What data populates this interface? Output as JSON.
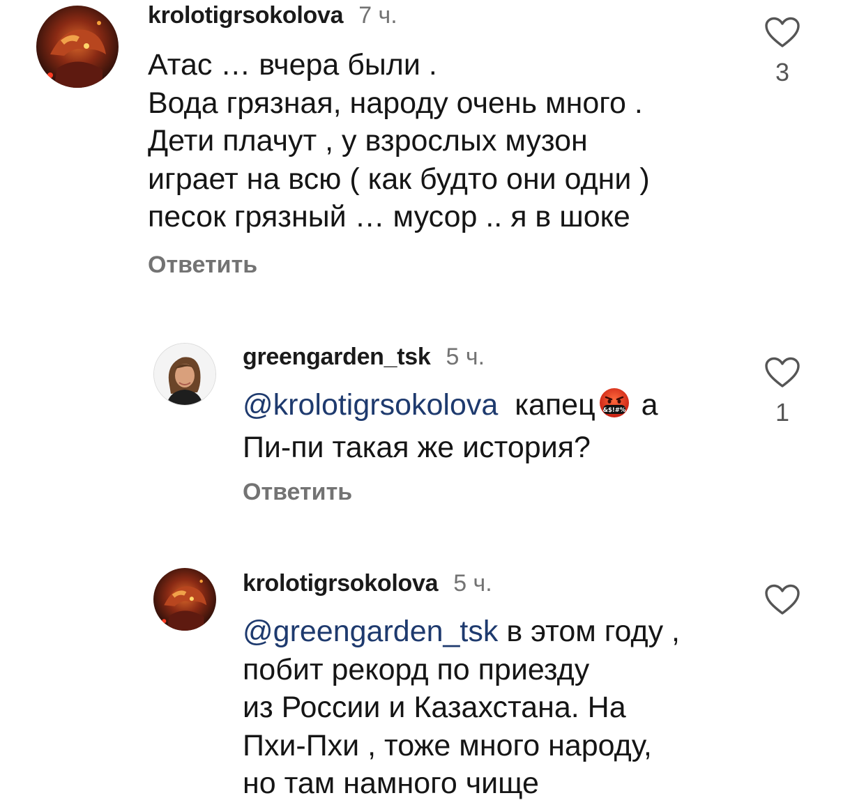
{
  "comments": [
    {
      "username": "krolotigrsokolova",
      "time": "7 ч.",
      "avatar": "dragon-avatar",
      "lines": [
        "Атас … вчера были .",
        "Вода грязная, народу очень много .",
        "Дети плачут , у взрослых музон",
        "играет на всю ( как будто они одни )",
        "песок грязный … мусор .. я в шоке"
      ],
      "reply_label": "Ответить",
      "likes": "3"
    },
    {
      "username": "greengarden_tsk",
      "time": "5 ч.",
      "avatar": "woman-portrait-avatar",
      "mention": "@krolotigrsokolova",
      "line1_rest": "капец",
      "emoji": "face-with-symbols-on-mouth",
      "line1_tail": "а",
      "line2": "Пи-пи такая же история?",
      "reply_label": "Ответить",
      "likes": "1"
    },
    {
      "username": "krolotigrsokolova",
      "time": "5 ч.",
      "avatar": "dragon-avatar",
      "mention": "@greengarden_tsk",
      "line1_rest": "в этом году ,",
      "lines": [
        "побит рекорд по приезду",
        "из России и Казахстана. На",
        "Пхи-Пхи , тоже много народу,",
        "но там намного чище"
      ]
    }
  ],
  "colors": {
    "text": "#151515",
    "muted": "#737373",
    "mention": "#1e3a6e",
    "heart_stroke": "#555555"
  },
  "icons": {
    "like": "heart-outline-icon",
    "emoji": "face-with-symbols-on-mouth"
  }
}
